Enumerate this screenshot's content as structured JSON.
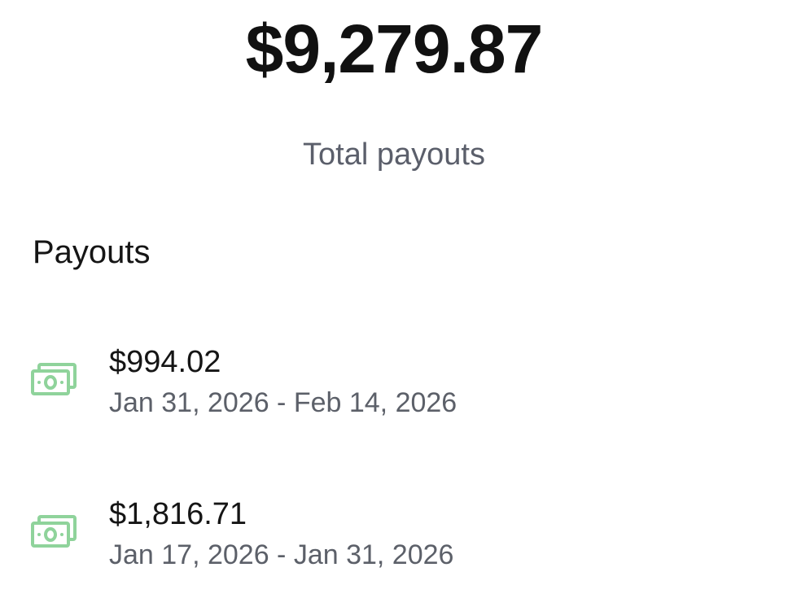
{
  "summary": {
    "total_amount": "$9,279.87",
    "total_label": "Total payouts"
  },
  "payouts": {
    "section_title": "Payouts",
    "items": [
      {
        "amount": "$994.02",
        "date_range": "Jan 31, 2026 - Feb 14, 2026",
        "icon": "cash-icon"
      },
      {
        "amount": "$1,816.71",
        "date_range": "Jan 17, 2026 - Jan 31, 2026",
        "icon": "cash-icon"
      }
    ]
  },
  "colors": {
    "icon_green": "#8fd39b",
    "muted_text": "#5b5f6b"
  }
}
